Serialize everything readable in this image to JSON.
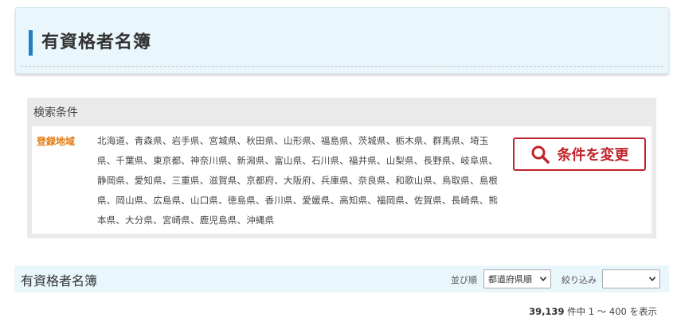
{
  "page": {
    "title": "有資格者名簿"
  },
  "search": {
    "header": "検索条件",
    "region_label": "登録地域",
    "prefectures": "北海道、青森県、岩手県、宮城県、秋田県、山形県、福島県、茨城県、栃木県、群馬県、埼玉県、千葉県、東京都、神奈川県、新潟県、富山県、石川県、福井県、山梨県、長野県、岐阜県、静岡県、愛知県、三重県、滋賀県、京都府、大阪府、兵庫県、奈良県、和歌山県、鳥取県、島根県、岡山県、広島県、山口県、徳島県、香川県、愛媛県、高知県、福岡県、佐賀県、長崎県、熊本県、大分県、宮崎県、鹿児島県、沖縄県",
    "change_button_label": "条件を変更"
  },
  "list": {
    "title": "有資格者名簿",
    "sort_label": "並び順",
    "sort_selected": "都道府県順",
    "filter_label": "絞り込み",
    "filter_selected": ""
  },
  "results": {
    "count": "39,139",
    "count_suffix": "件中",
    "range": "1 ～ 400 を表示"
  },
  "icons": {
    "change_button": "search-icon",
    "sort_select": "chevron-down-icon",
    "filter_select": "chevron-down-icon"
  },
  "colors": {
    "accent_blue": "#1f7fc6",
    "title_bg": "#e9f6fc",
    "label_orange": "#e07b12",
    "button_red": "#c0232b"
  }
}
